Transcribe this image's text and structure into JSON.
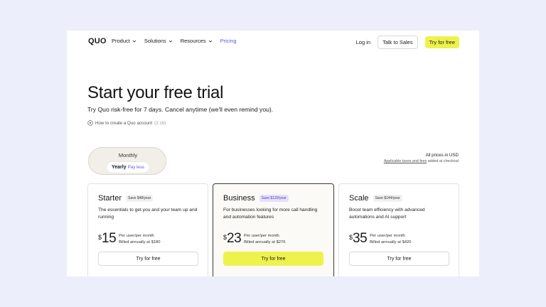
{
  "nav": {
    "logo": "QUO",
    "links": [
      {
        "label": "Product",
        "dropdown": true
      },
      {
        "label": "Solutions",
        "dropdown": true
      },
      {
        "label": "Resources",
        "dropdown": true
      },
      {
        "label": "Pricing",
        "dropdown": false,
        "active": true
      }
    ],
    "login": "Log in",
    "talk_to_sales": "Talk to Sales",
    "try_free": "Try for free"
  },
  "hero": {
    "title": "Start your free trial",
    "subtitle": "Try Quo risk-free for 7 days. Cancel anytime (we'll even remind you).",
    "howto": "How to create a Quo account",
    "howto_duration": "(2:16)"
  },
  "billing": {
    "monthly": "Monthly",
    "yearly": "Yearly",
    "pay_less": "Pay less"
  },
  "prices_note": {
    "line1": "All prices in USD",
    "taxes_link": "Applicable taxes and fees",
    "taxes_suffix": "added at checkout"
  },
  "plans": [
    {
      "name": "Starter",
      "save": "Save $48/year",
      "description": "The essentials to get you and your team up and running",
      "currency": "$",
      "price": "15",
      "per": "Per user/per month",
      "billed": "Billed annually at $180",
      "cta": "Try for free"
    },
    {
      "name": "Business",
      "save": "Save $120/year",
      "description": "For businesses looking for more call handling and automation features",
      "currency": "$",
      "price": "23",
      "per": "Per user/per month",
      "billed": "Billed annually at $276",
      "cta": "Try for free"
    },
    {
      "name": "Scale",
      "save": "Save $144/year",
      "description": "Boost team efficiency with advanced automations and AI support",
      "currency": "$",
      "price": "35",
      "per": "Per user/per month",
      "billed": "Billed annually at $420",
      "cta": "Try for free"
    }
  ],
  "colors": {
    "accent_yellow": "#eef24d",
    "accent_purple": "#5b5bd6",
    "background": "#eceefb"
  }
}
